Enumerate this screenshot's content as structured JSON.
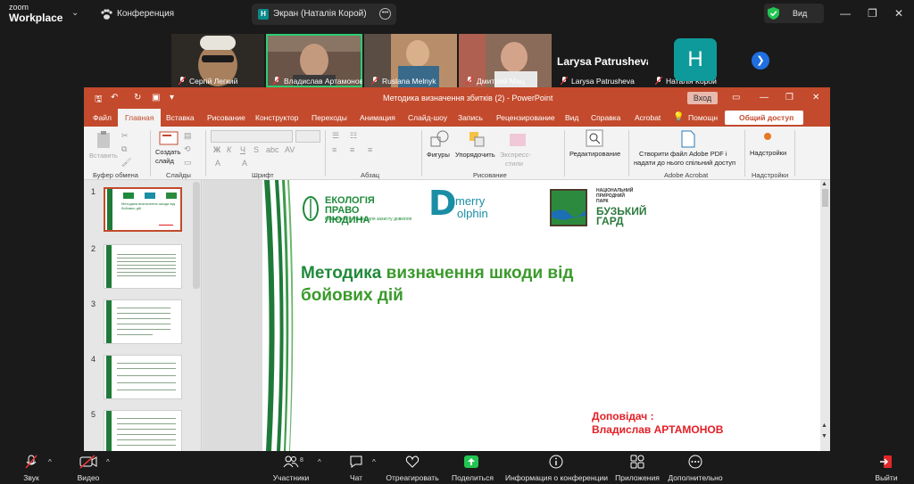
{
  "zoom": {
    "logo_line1": "zoom",
    "logo_line2": "Workplace",
    "conference_label": "Конференция",
    "share_badge": "H",
    "share_title": "Экран (Наталія Корой)",
    "view_label": "Вид"
  },
  "participants": [
    {
      "name": "Сергій Легкий"
    },
    {
      "name": "Владислав Артамонов",
      "active": true
    },
    {
      "name": "Ruslana Melnyk"
    },
    {
      "name": "Дмитрий Мац"
    },
    {
      "name": "Larysa Patrusheva"
    },
    {
      "name": "Наталія Корой"
    }
  ],
  "big_name": "Larysa Patrusheva",
  "avatar_letter": "H",
  "powerpoint": {
    "filename": "Методика визначення збитків (2)  -  PowerPoint",
    "login": "Вход",
    "tabs": [
      "Файл",
      "Главная",
      "Вставка",
      "Рисование",
      "Конструктор",
      "Переходы",
      "Анимация",
      "Слайд-шоу",
      "Запись",
      "Рецензирование",
      "Вид",
      "Справка",
      "Acrobat"
    ],
    "selected_tab": "Главная",
    "help": "Помощн",
    "share": "Общий доступ",
    "ribbon": {
      "paste": "Вставить",
      "clipboard": "Буфер обмена",
      "create_slide": "Создать",
      "create_slide2": "слайд",
      "slides": "Слайды",
      "font": "Шрифт",
      "paragraph": "Абзац",
      "shapes": "Фигуры",
      "arrange": "Упорядочить",
      "quick_styles": "Экспресс-",
      "quick_styles2": "стили",
      "drawing": "Рисование",
      "editing": "Редактирование",
      "adobe_btn1": "Створити файл Adobe PDF і",
      "adobe_btn2": "надати до нього спільний доступ",
      "adobe": "Adobe Acrobat",
      "addins_btn": "Надстройки",
      "addins": "Надстройки"
    },
    "slide_numbers": [
      "1",
      "2",
      "3",
      "4",
      "5"
    ],
    "slide": {
      "eco_line1": "ЕКОЛОГІЯ",
      "eco_line2": "ПРАВО ЛЮДИНА",
      "eco_tagline": "Незалежність права для захисту довкілля",
      "dolphin_d": "D",
      "dolphin_merry": "merry",
      "dolphin_olphin": "olphin",
      "park_small1": "НАЦІОНАЛЬНИЙ",
      "park_small2": "ПРИРОДНИЙ",
      "park_small3": "ПАРК",
      "park_big1": "БУЗЬКИЙ",
      "park_big2": "ГАРД",
      "title_part1": "Методика ",
      "title_part2": "визначення шкоди від бойових дій",
      "speaker_label": "Доповідач :",
      "speaker_name": "Владислав АРТАМОНОВ"
    },
    "thumb1_title": "Методика визначення шкоди від бойових дій"
  },
  "toolbar": {
    "audio": "Звук",
    "video": "Видео",
    "participants": "Участники",
    "participants_count": "8",
    "chat": "Чат",
    "react": "Отреагировать",
    "share": "Поделиться",
    "info": "Информация о конференции",
    "apps": "Приложения",
    "more": "Дополнительно",
    "leave": "Выйти"
  },
  "colors": {
    "ppt_accent": "#c34a2c",
    "active_speaker": "#2ecc71",
    "slide_green": "#1f8a3a",
    "speaker_red": "#e31e24"
  }
}
